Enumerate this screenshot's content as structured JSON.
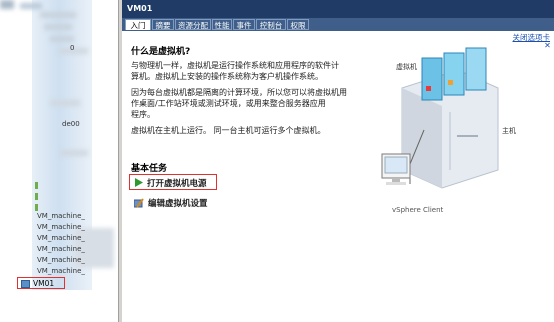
{
  "window": {
    "title": "VM01"
  },
  "tabs": [
    "入门",
    "摘要",
    "资源分配",
    "性能",
    "事件",
    "控制台",
    "权限"
  ],
  "close_tab": "关闭选项卡",
  "tree": {
    "items": [
      "VM_machine_",
      "VM_machine_",
      "VM_machine_",
      "VM_machine_",
      "VM_machine_",
      "VM_machine_"
    ],
    "fragment_suffix_1": "0",
    "fragment_suffix_2": "de00",
    "selected": "VM01"
  },
  "intro": {
    "heading": "什么是虚拟机?",
    "para1_line1": "与物理机一样，虚拟机是运行操作系统和应用程序的软件计",
    "para1_line2": "算机。虚拟机上安装的操作系统称为客户机操作系统。",
    "para2_line1": "因为每台虚拟机都是隔离的计算环境，所以您可以将虚拟机用",
    "para2_line2": "作桌面/工作站环境或测试环境，或用来整合服务器应用",
    "para2_line3": "程序。",
    "para3": "虚拟机在主机上运行。 同一台主机可运行多个虚拟机。"
  },
  "tasks": {
    "heading": "基本任务",
    "power_on": "打开虚拟机电源",
    "edit_settings": "编辑虚拟机设置"
  },
  "diagram": {
    "vm_label": "虚拟机",
    "host_label": "主机",
    "client_label": "vSphere Client"
  }
}
